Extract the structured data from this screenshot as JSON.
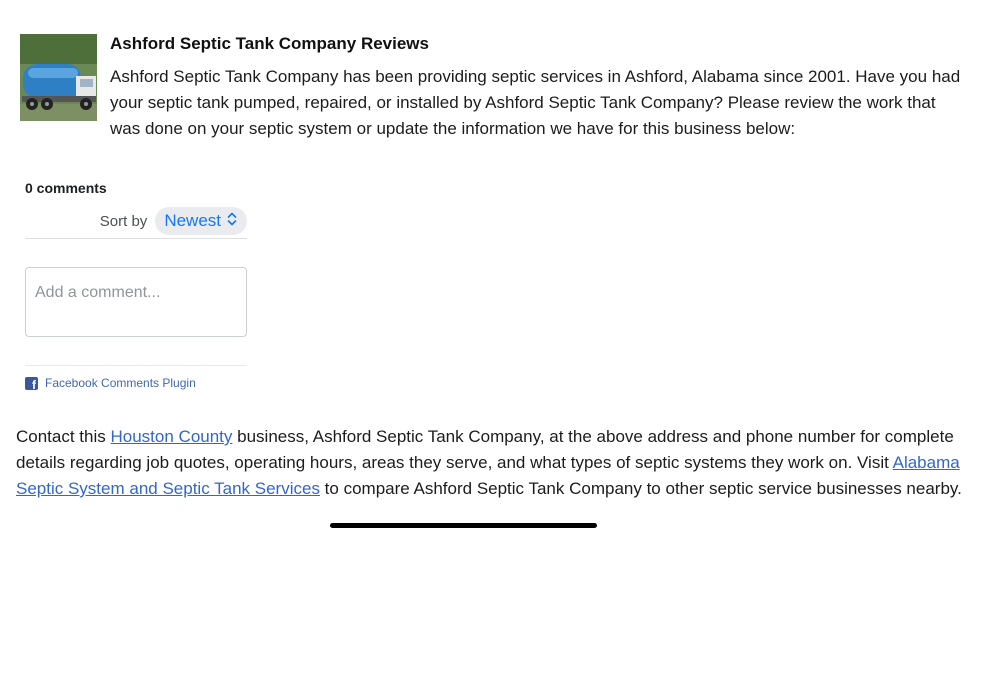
{
  "review": {
    "title": "Ashford Septic Tank Company Reviews",
    "description": "Ashford Septic Tank Company has been providing septic services in Ashford, Alabama since 2001. Have you had your septic tank pumped, repaired, or installed by Ashford Septic Tank Company? Please review the work that was done on your septic system or update the information we have for this business below:",
    "thumbnail_icon": "septic-truck-photo"
  },
  "comments": {
    "count_label": "0 comments",
    "sort_label": "Sort by",
    "sort_value": "Newest",
    "comment_placeholder": "Add a comment...",
    "plugin_label": "Facebook Comments Plugin",
    "plugin_icon": "facebook-icon",
    "accent_color": "#1877f2"
  },
  "contact": {
    "text_1": "Contact this ",
    "county_link": "Houston County",
    "text_2": " business, Ashford Septic Tank Company, at the above address and phone number for complete details regarding job quotes, operating hours, areas they serve, and what types of septic systems they work on. Visit ",
    "services_link": "Alabama Septic System and Septic Tank Services",
    "text_3": " to compare Ashford Septic Tank Company to other septic service businesses nearby.",
    "link_color": "#3366cc"
  }
}
